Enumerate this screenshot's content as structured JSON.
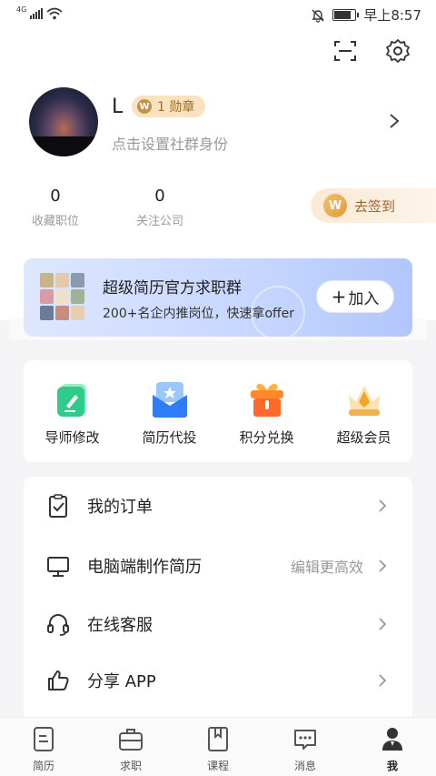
{
  "status_bar": {
    "network": "4G",
    "time": "早上8:57",
    "icons": [
      "signal-icon",
      "wifi-icon",
      "mute-bell-icon",
      "battery-icon"
    ]
  },
  "header": {
    "icons": [
      "scan-icon",
      "settings-gear-icon"
    ]
  },
  "profile": {
    "name": "L",
    "badge": "1 勋章",
    "badge_icon_letter": "W",
    "subtitle": "点击设置社群身份"
  },
  "stats": [
    {
      "value": "0",
      "label": "收藏职位"
    },
    {
      "value": "0",
      "label": "关注公司"
    }
  ],
  "checkin": {
    "label": "去签到",
    "icon_letter": "W"
  },
  "banner": {
    "title": "超级简历官方求职群",
    "subtitle": "200+名企内推岗位，快速拿offer",
    "button": "加入",
    "button_icon": "+"
  },
  "tools": [
    {
      "label": "导师修改",
      "icon": "mentor-edit-icon"
    },
    {
      "label": "简历代投",
      "icon": "resume-delivery-icon"
    },
    {
      "label": "积分兑换",
      "icon": "points-gift-icon"
    },
    {
      "label": "超级会员",
      "icon": "vip-crown-icon"
    }
  ],
  "menu": [
    {
      "label": "我的订单",
      "hint": "",
      "icon": "order-clipboard-icon"
    },
    {
      "label": "电脑端制作简历",
      "hint": "编辑更高效",
      "icon": "desktop-monitor-icon"
    },
    {
      "label": "在线客服",
      "hint": "",
      "icon": "headset-icon"
    },
    {
      "label": "分享 APP",
      "hint": "",
      "icon": "thumbs-up-icon"
    }
  ],
  "tabbar": [
    {
      "label": "简历",
      "icon": "resume-doc-icon"
    },
    {
      "label": "求职",
      "icon": "briefcase-icon"
    },
    {
      "label": "课程",
      "icon": "course-book-icon"
    },
    {
      "label": "消息",
      "icon": "message-bubble-icon"
    },
    {
      "label": "我",
      "icon": "profile-person-icon",
      "active": true
    }
  ],
  "colors": {
    "accent_gold": "#c59247",
    "banner_blue": "#c6d6ff",
    "page_grey": "#f4f4f6"
  }
}
